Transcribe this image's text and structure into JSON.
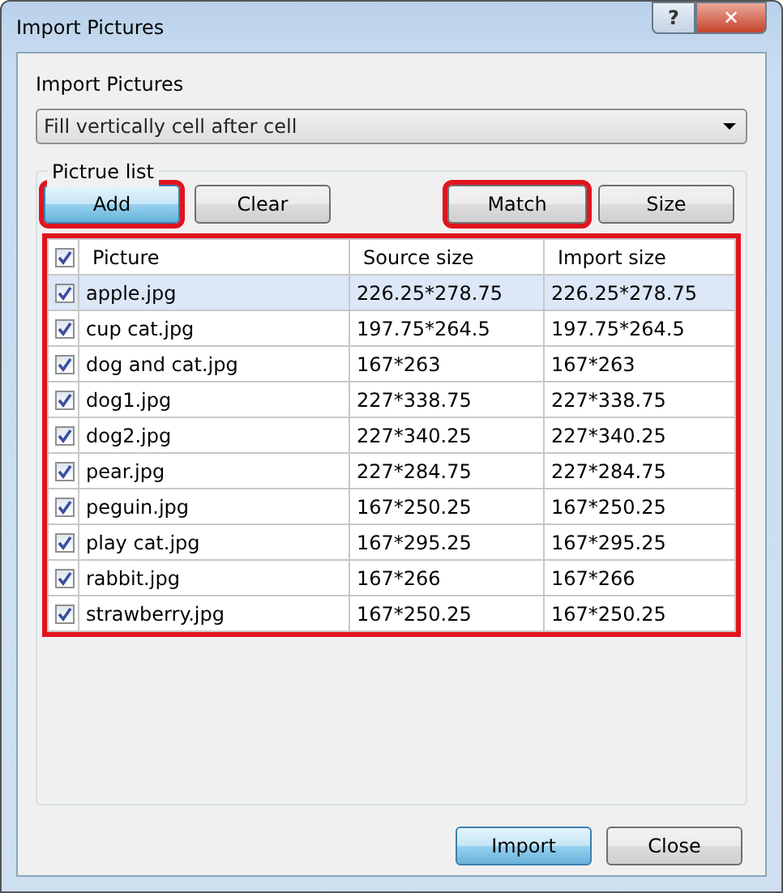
{
  "window": {
    "title": "Import Pictures",
    "controls": [
      "?",
      "✕"
    ]
  },
  "import_group": {
    "label": "Import Pictures",
    "dropdown": {
      "value": "Fill vertically cell after cell"
    }
  },
  "picture_list": {
    "label": "Pictrue list",
    "buttons": [
      {
        "label": "Add",
        "highlighted": true,
        "focused": true
      },
      {
        "label": "Clear",
        "highlighted": false,
        "focused": false
      },
      {
        "label": "Match",
        "highlighted": true,
        "focused": false
      },
      {
        "label": "Size",
        "highlighted": false,
        "focused": false
      }
    ],
    "table": {
      "highlighted": true,
      "header_checked": true,
      "columns": [
        "Picture",
        "Source size",
        "Import size"
      ],
      "rows": [
        {
          "checked": true,
          "selected": true,
          "cells": [
            "apple.jpg",
            "226.25*278.75",
            "226.25*278.75"
          ]
        },
        {
          "checked": true,
          "selected": false,
          "cells": [
            "cup cat.jpg",
            "197.75*264.5",
            "197.75*264.5"
          ]
        },
        {
          "checked": true,
          "selected": false,
          "cells": [
            "dog and cat.jpg",
            "167*263",
            "167*263"
          ]
        },
        {
          "checked": true,
          "selected": false,
          "cells": [
            "dog1.jpg",
            "227*338.75",
            "227*338.75"
          ]
        },
        {
          "checked": true,
          "selected": false,
          "cells": [
            "dog2.jpg",
            "227*340.25",
            "227*340.25"
          ]
        },
        {
          "checked": true,
          "selected": false,
          "cells": [
            "pear.jpg",
            "227*284.75",
            "227*284.75"
          ]
        },
        {
          "checked": true,
          "selected": false,
          "cells": [
            "peguin.jpg",
            "167*250.25",
            "167*250.25"
          ]
        },
        {
          "checked": true,
          "selected": false,
          "cells": [
            "play cat.jpg",
            "167*295.25",
            "167*295.25"
          ]
        },
        {
          "checked": true,
          "selected": false,
          "cells": [
            "rabbit.jpg",
            "167*266",
            "167*266"
          ]
        },
        {
          "checked": true,
          "selected": false,
          "cells": [
            "strawberry.jpg",
            "167*250.25",
            "167*250.25"
          ]
        }
      ]
    }
  },
  "footer_buttons": [
    {
      "label": "Import",
      "focused": true
    },
    {
      "label": "Close",
      "focused": false
    }
  ]
}
